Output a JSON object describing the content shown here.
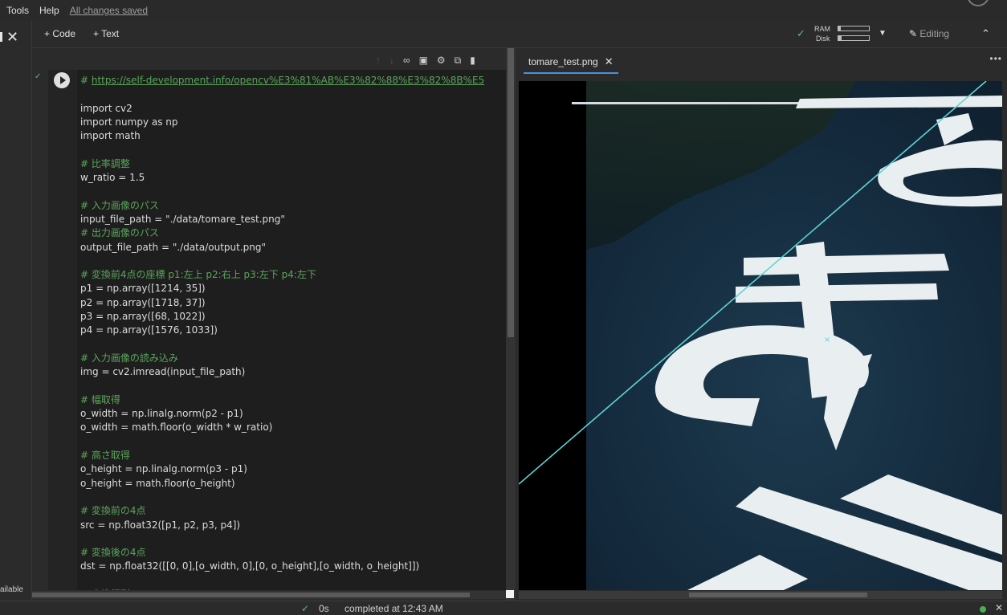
{
  "menu": {
    "items": [
      "Tools",
      "Help"
    ],
    "saved": "All changes saved"
  },
  "leftrail": {
    "close": "✕",
    "available": "ailable"
  },
  "toolbar": {
    "code_btn": "+ Code",
    "text_btn": "+ Text",
    "ram": "RAM",
    "disk": "Disk",
    "ram_level": 0.08,
    "disk_level": 0.1,
    "editing": "Editing",
    "connected_check": "✓"
  },
  "cell": {
    "toolbar_icons": [
      "arrow-up-icon",
      "arrow-down-icon",
      "link-icon",
      "comment-icon",
      "gear-icon",
      "mirror-icon",
      "delete-icon"
    ],
    "lines": [
      {
        "t": "# https://self-development.info/opencv%E3%81%AB%E3%82%88%E3%82%8B%E5",
        "k": "url"
      },
      {
        "t": "",
        "k": ""
      },
      {
        "t": "import cv2",
        "k": ""
      },
      {
        "t": "import numpy as np",
        "k": ""
      },
      {
        "t": "import math",
        "k": ""
      },
      {
        "t": "",
        "k": ""
      },
      {
        "t": "# 比率調整",
        "k": "c"
      },
      {
        "t": "w_ratio = 1.5",
        "k": ""
      },
      {
        "t": "",
        "k": ""
      },
      {
        "t": "# 入力画像のパス",
        "k": "c"
      },
      {
        "t": "input_file_path = \"./data/tomare_test.png\"",
        "k": ""
      },
      {
        "t": "# 出力画像のパス",
        "k": "c"
      },
      {
        "t": "output_file_path = \"./data/output.png\"",
        "k": ""
      },
      {
        "t": "",
        "k": ""
      },
      {
        "t": "# 変換前4点の座標 p1:左上 p2:右上 p3:左下 p4:左下",
        "k": "c"
      },
      {
        "t": "p1 = np.array([1214, 35])",
        "k": ""
      },
      {
        "t": "p2 = np.array([1718, 37])",
        "k": ""
      },
      {
        "t": "p3 = np.array([68, 1022])",
        "k": ""
      },
      {
        "t": "p4 = np.array([1576, 1033])",
        "k": ""
      },
      {
        "t": "",
        "k": ""
      },
      {
        "t": "# 入力画像の読み込み",
        "k": "c"
      },
      {
        "t": "img = cv2.imread(input_file_path)",
        "k": ""
      },
      {
        "t": "",
        "k": ""
      },
      {
        "t": "# 幅取得",
        "k": "c"
      },
      {
        "t": "o_width = np.linalg.norm(p2 - p1)",
        "k": ""
      },
      {
        "t": "o_width = math.floor(o_width * w_ratio)",
        "k": ""
      },
      {
        "t": "",
        "k": ""
      },
      {
        "t": "# 高さ取得",
        "k": "c"
      },
      {
        "t": "o_height = np.linalg.norm(p3 - p1)",
        "k": ""
      },
      {
        "t": "o_height = math.floor(o_height)",
        "k": ""
      },
      {
        "t": "",
        "k": ""
      },
      {
        "t": "# 変換前の4点",
        "k": "c"
      },
      {
        "t": "src = np.float32([p1, p2, p3, p4])",
        "k": ""
      },
      {
        "t": "",
        "k": ""
      },
      {
        "t": "# 変換後の4点",
        "k": "c"
      },
      {
        "t": "dst = np.float32([[0, 0],[o_width, 0],[0, o_height],[o_width, o_height]])",
        "k": ""
      },
      {
        "t": "",
        "k": ""
      },
      {
        "t": "# 変換行列",
        "k": "c"
      }
    ]
  },
  "viewer": {
    "tab_label": "tomare_test.png",
    "tab_close": "✕",
    "more": "•••"
  },
  "status": {
    "check": "✓",
    "duration": "0s",
    "completed": "completed at 12:43 AM",
    "close": "✕"
  },
  "colors": {
    "accent": "#4a90e2",
    "ok": "#66bb6a",
    "comment": "#5aa65a"
  }
}
